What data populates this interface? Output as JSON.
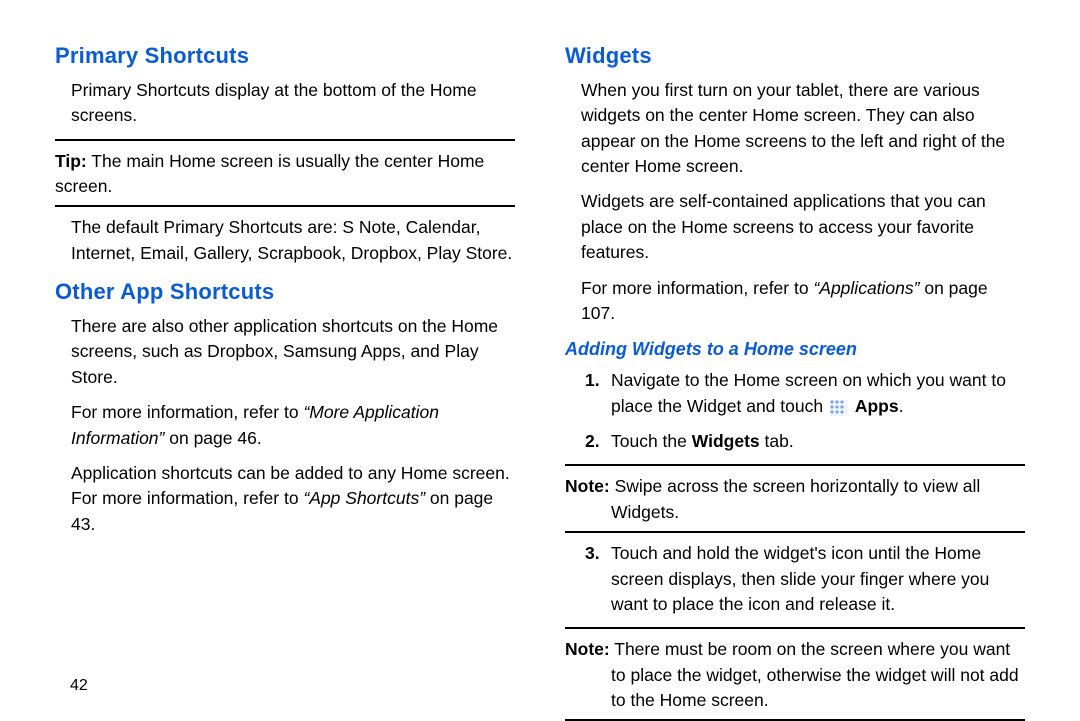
{
  "page_number": "42",
  "left": {
    "h1": "Primary Shortcuts",
    "p1": "Primary Shortcuts display at the bottom of the Home screens.",
    "tip_label": "Tip:",
    "tip_text": " The main Home screen is usually the center Home screen.",
    "p2": "The default Primary Shortcuts are: S Note, Calendar, Internet, Email, Gallery, Scrapbook, Dropbox, Play Store.",
    "h2": "Other App Shortcuts",
    "p3": "There are also other application shortcuts on the Home screens, such as Dropbox, Samsung Apps, and Play Store.",
    "p4a": "For more information, refer to ",
    "p4_ref": "“More Application Information”",
    "p4b": " on page 46.",
    "p5a": "Application shortcuts can be added to any Home screen. For more information, refer to ",
    "p5_ref": "“App Shortcuts”",
    "p5b": " on page 43."
  },
  "right": {
    "h1": "Widgets",
    "p1": "When you first turn on your tablet, there are various widgets on the center Home screen. They can also appear on the Home screens to the left and right of the center Home screen.",
    "p2": "Widgets are self-contained applications that you can place on the Home screens to access your favorite features.",
    "p3a": "For more information, refer to ",
    "p3_ref": "“Applications”",
    "p3b": " on page 107.",
    "h2": "Adding Widgets to a Home screen",
    "step1_num": "1.",
    "step1a": "Navigate to the Home screen on which you want to place the Widget and touch ",
    "step1_bold": "Apps",
    "step1b": ".",
    "step2_num": "2.",
    "step2a": "Touch the ",
    "step2_bold": "Widgets",
    "step2b": " tab.",
    "note1_label": "Note:",
    "note1_text": " Swipe across the screen horizontally to view all Widgets.",
    "step3_num": "3.",
    "step3": "Touch and hold the widget's icon until the Home screen displays, then slide your finger where you want to place the icon and release it.",
    "note2_label": "Note:",
    "note2_text": " There must be room on the screen where you want to place the widget, otherwise the widget will not add to the Home screen."
  }
}
